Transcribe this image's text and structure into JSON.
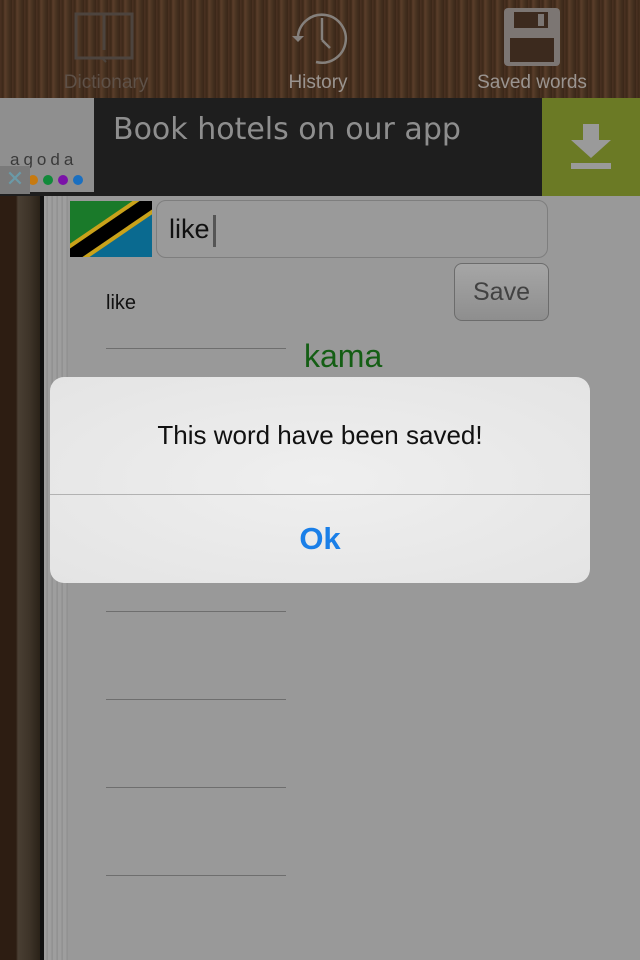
{
  "tabs": [
    {
      "label": "Dictionary",
      "icon": "book-icon",
      "state": "active"
    },
    {
      "label": "History",
      "icon": "clock-history-icon",
      "state": "inactive"
    },
    {
      "label": "Saved words",
      "icon": "floppy-disk-icon",
      "state": "inactive"
    }
  ],
  "ad": {
    "brand": "agoda",
    "brand_dot_colors": [
      "#c77a10",
      "#118a3a",
      "#7b12a8",
      "#1a6fc0"
    ],
    "text": "Book hotels on our app",
    "close_icon": "close-icon",
    "download_icon": "download-icon",
    "download_bg": "#6b7a25"
  },
  "search": {
    "flag": "tanzania-flag",
    "value": "like"
  },
  "save_button": {
    "label": "Save"
  },
  "result": {
    "source_word": "like",
    "translation": "kama",
    "translation_color": "#145e14"
  },
  "dialog": {
    "message": "This word have been saved!",
    "ok_label": "Ok",
    "ok_color": "#1a7fe8"
  }
}
